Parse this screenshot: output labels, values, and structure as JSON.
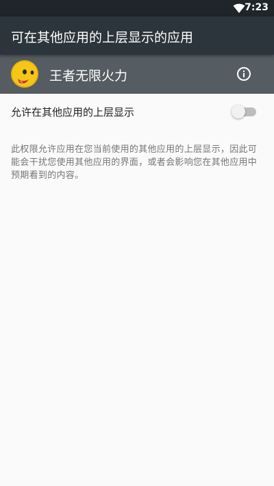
{
  "status_bar": {
    "time": "7:23",
    "icons": [
      "wifi-icon"
    ]
  },
  "app_bar": {
    "title": "可在其他应用的上层显示的应用"
  },
  "app_header": {
    "app_name": "王者无限火力",
    "icons": [
      "app-icon",
      "info-icon"
    ]
  },
  "permission": {
    "label": "允许在其他应用的上层显示",
    "enabled": false,
    "description": "此权限允许应用在您当前使用的其他应用的上层显示，因此可能会干扰您使用其他应用的界面，或者会影响您在其他应用中预期看到的内容。"
  },
  "colors": {
    "status_bar": "#1f2529",
    "app_bar": "#2c353b",
    "app_header": "#555d62",
    "background": "#fafafa",
    "switch_track_off": "#bdbdbd",
    "switch_thumb_off": "#f1f1f1"
  }
}
